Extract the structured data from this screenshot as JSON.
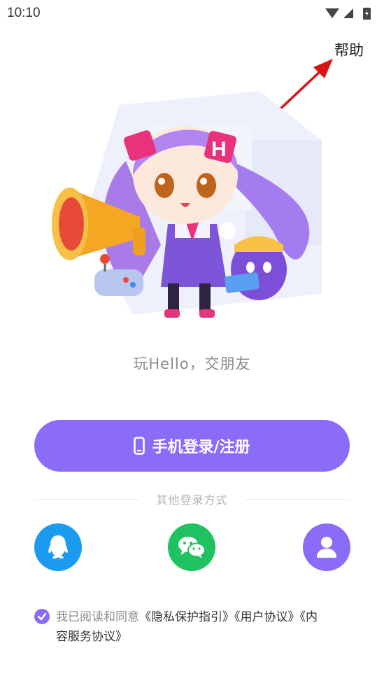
{
  "status": {
    "time": "10:10"
  },
  "header": {
    "help_label": "帮助"
  },
  "hero": {
    "slogan": "玩Hello，交朋友",
    "badge_letter": "H"
  },
  "login": {
    "phone_login_label": "手机登录/注册"
  },
  "other": {
    "label": "其他登录方式",
    "options": [
      "qq-icon",
      "wechat-icon",
      "user-icon"
    ],
    "colors": {
      "qq": "#1b9bf0",
      "wechat": "#1fc160",
      "account": "#8a6cf8"
    }
  },
  "agreement": {
    "prefix": "我已阅读和同意",
    "privacy": "《隐私保护指引》",
    "user": "《用户协议》",
    "content": "《内容服务协议》",
    "content_a": "《内",
    "content_b": "容服务协议》"
  },
  "accent_color": "#8a6cf8"
}
